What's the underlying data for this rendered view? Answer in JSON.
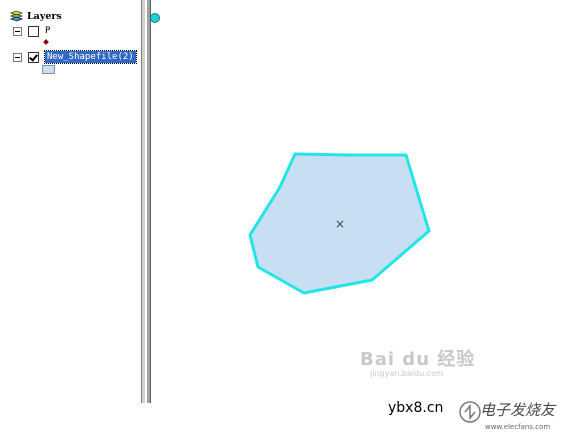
{
  "toc": {
    "root_label": "Layers",
    "layers": [
      {
        "name": "P",
        "checked": false,
        "symbol": "point-diamond",
        "symbol_color": "#8b0000"
      },
      {
        "name": "New_Shapefile(2)",
        "checked": true,
        "selected": true,
        "symbol": "polygon-swatch",
        "symbol_color": "#c8def2"
      }
    ]
  },
  "map": {
    "polygon_fill": "#c8def2",
    "polygon_stroke": "#22e5e5",
    "centroid_marker": "×"
  },
  "watermarks": {
    "baidu": "Bai du 经验",
    "baidu_sub": "jingyan.baidu.com",
    "site": "ybx8.cn",
    "logo_text": "电子发烧友",
    "logo_url": "www.elecfans.com"
  },
  "colors": {
    "selection": "#316ac5",
    "splitter": "#d4d0c8",
    "handle": "#20d0d0"
  }
}
